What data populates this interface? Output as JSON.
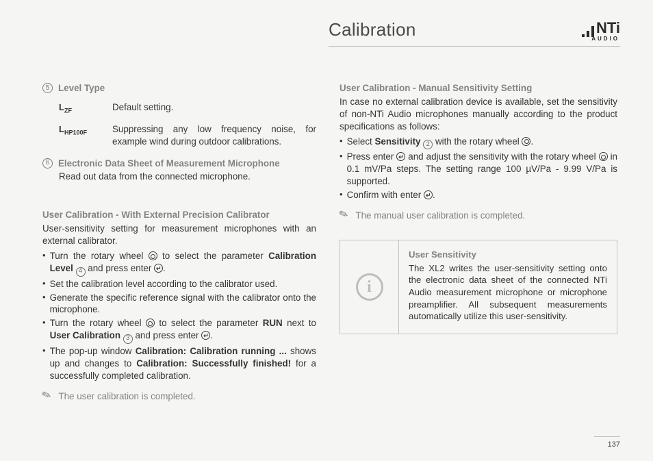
{
  "header": {
    "title": "Calibration",
    "brand_main": "NTi",
    "brand_sub": "AUDIO"
  },
  "left": {
    "item5_num": "5",
    "item5_head": "Level Type",
    "lzf_label_pre": "L",
    "lzf_label_sub": "ZF",
    "lzf_text": "Default setting.",
    "lhp_label_pre": "L",
    "lhp_label_sub": "HP100F",
    "lhp_text": "Suppressing any low frequency noise, for example wind during outdoor calibrations.",
    "item6_num": "6",
    "item6_head": "Electronic Data Sheet of Measurement Microphone",
    "item6_text": "Read out data from the connected microphone.",
    "cal_ext_head": "User Calibration - With External Precision Calibrator",
    "cal_ext_intro": "User-sensitivity setting for measurement microphones with an external calibrator.",
    "b1_a": "Turn the rotary wheel ",
    "b1_b": " to select the parameter ",
    "b1_bold": "Calibration Level",
    "b1_c": " and press enter ",
    "b1_num": "4",
    "b2": "Set the calibration level according to the calibrator used.",
    "b3": "Generate the specific reference signal with the calibrator onto the microphone.",
    "b4_a": "Turn the rotary wheel ",
    "b4_b": " to select the parameter ",
    "b4_bold": "RUN",
    "b4_c": " next to ",
    "b4_bold2": "User Calibration",
    "b4_num": "3",
    "b4_d": " and press enter ",
    "b5_a": "The pop-up window ",
    "b5_bold1": "Calibration: Calibration running ...",
    "b5_b": " shows up and changes to ",
    "b5_bold2": "Calibration: Successfully finished!",
    "b5_c": " for a successfully completed calibration.",
    "done": "The user calibration is completed."
  },
  "right": {
    "head": "User Calibration - Manual Sensitivity Setting",
    "intro": "In case no external calibration device is available, set the sensitivity of non-NTi Audio microphones manually according to the product specifications as follows:",
    "r1_a": "Select ",
    "r1_bold": "Sensitivity",
    "r1_num": "2",
    "r1_b": " with the rotary wheel ",
    "r2_a": "Press enter ",
    "r2_b": " and adjust the sensitivity with the rotary wheel ",
    "r2_c": "  in 0.1 mV/Pa steps. The setting range 100 µV/Pa - 9.99 V/Pa is supported.",
    "r3_a": "Confirm with enter ",
    "done": "The manual user calibration is completed.",
    "info_head": "User Sensitivity",
    "info_body": "The XL2 writes the user-sensitivity setting onto the electronic data sheet of the connected NTi Audio measurement microphone or microphone preamplifier. All subsequent measurements automatically utilize this user-sensitivity."
  },
  "page_number": "137"
}
